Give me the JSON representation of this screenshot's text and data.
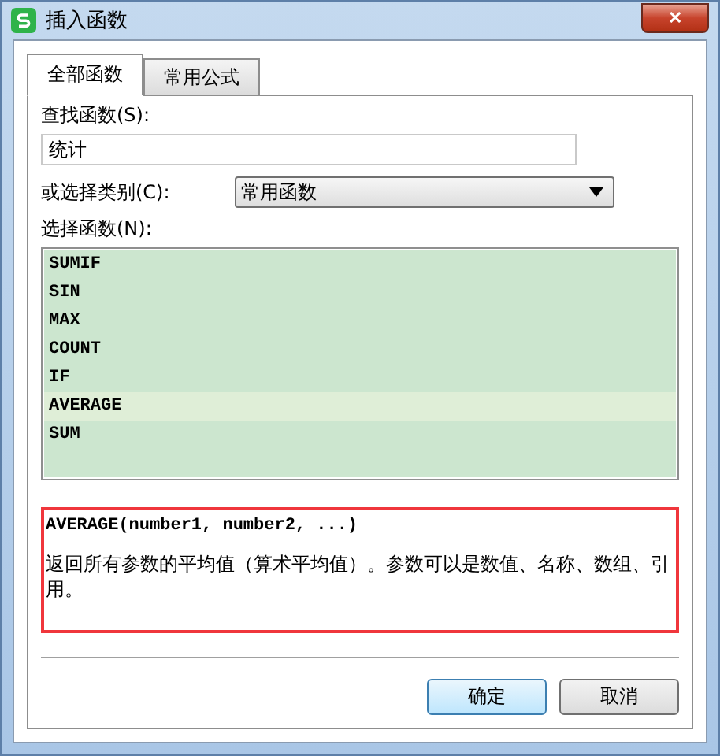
{
  "window": {
    "title": "插入函数",
    "close": "✕"
  },
  "tabs": [
    {
      "label": "全部函数",
      "selected": true
    },
    {
      "label": "常用公式",
      "selected": false
    }
  ],
  "search": {
    "label": "查找函数(S):",
    "value": "统计"
  },
  "category": {
    "label": "或选择类别(C):",
    "value": "常用函数"
  },
  "functions": {
    "label": "选择函数(N):",
    "items": [
      {
        "name": "SUMIF",
        "selected": false
      },
      {
        "name": "SIN",
        "selected": false
      },
      {
        "name": "MAX",
        "selected": false
      },
      {
        "name": "COUNT",
        "selected": false
      },
      {
        "name": "IF",
        "selected": false
      },
      {
        "name": "AVERAGE",
        "selected": true
      },
      {
        "name": "SUM",
        "selected": false
      }
    ]
  },
  "description": {
    "signature": "AVERAGE(number1, number2, ...)",
    "text": "返回所有参数的平均值（算术平均值）。参数可以是数值、名称、数组、引用。"
  },
  "buttons": [
    {
      "label": "确定",
      "primary": true
    },
    {
      "label": "取消",
      "primary": false
    }
  ]
}
